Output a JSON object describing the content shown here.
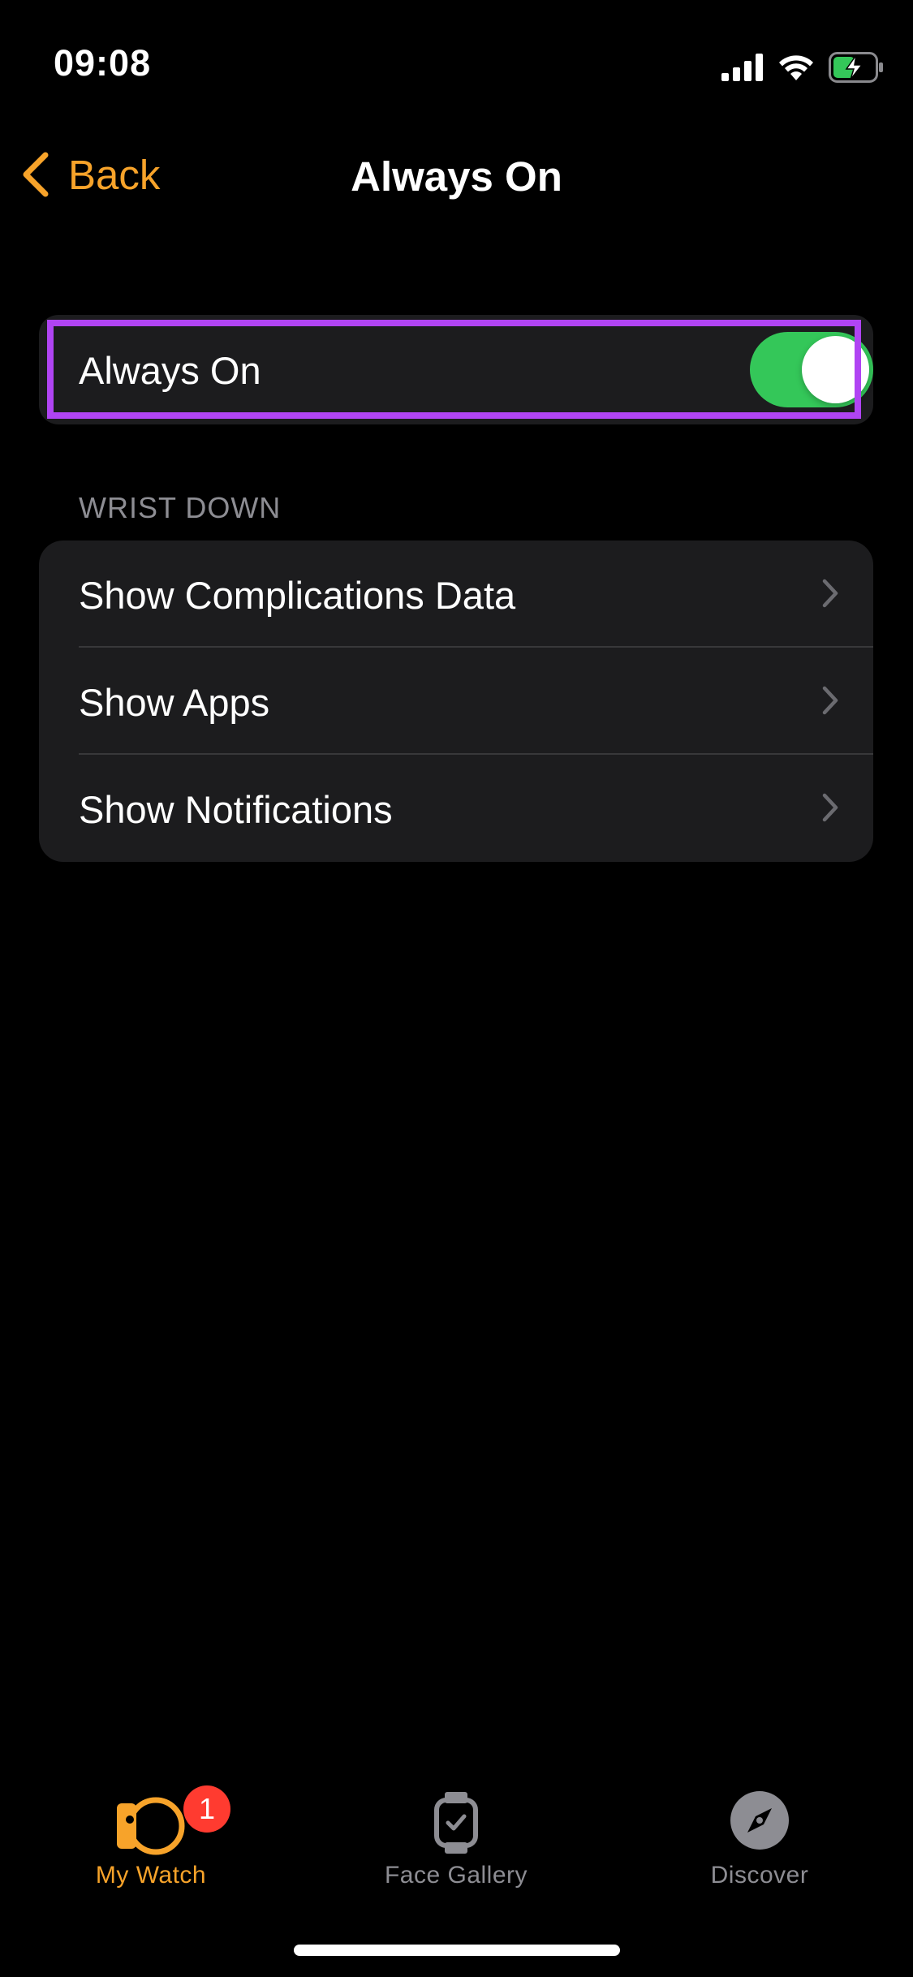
{
  "status_bar": {
    "time": "09:08"
  },
  "nav": {
    "back_label": "Back",
    "title": "Always On"
  },
  "always_on": {
    "label": "Always On",
    "enabled": true
  },
  "section": {
    "header": "WRIST DOWN",
    "items": [
      {
        "label": "Show Complications Data"
      },
      {
        "label": "Show Apps"
      },
      {
        "label": "Show Notifications"
      }
    ]
  },
  "tab_bar": {
    "tabs": [
      {
        "label": "My Watch",
        "icon": "watch-icon",
        "active": true,
        "badge": "1"
      },
      {
        "label": "Face Gallery",
        "icon": "watch-face-icon",
        "active": false
      },
      {
        "label": "Discover",
        "icon": "compass-icon",
        "active": false
      }
    ]
  },
  "colors": {
    "accent": "#f7a32a",
    "toggle_on": "#34c759",
    "highlight": "#b044f3",
    "badge": "#ff3b30",
    "card_bg": "#1c1c1e"
  }
}
